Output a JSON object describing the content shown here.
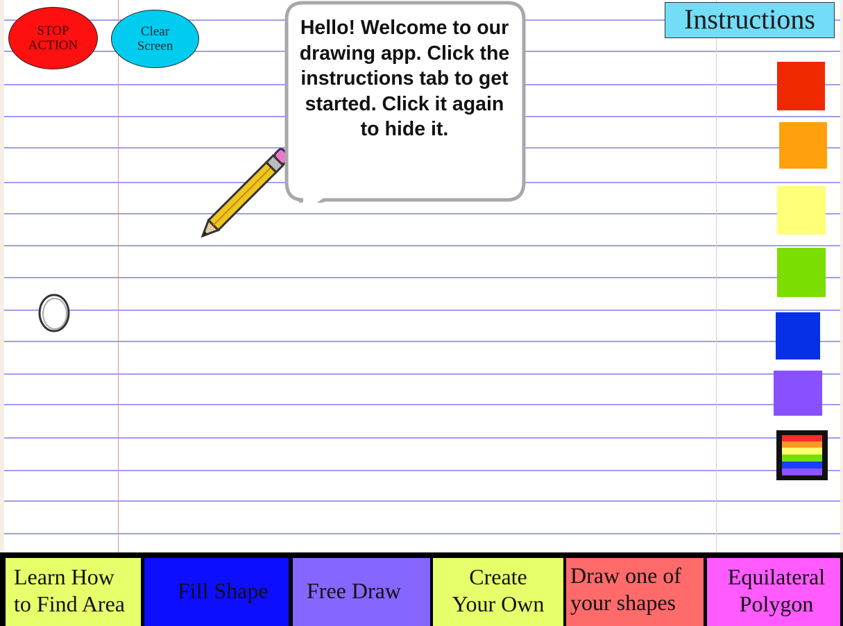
{
  "buttons": {
    "stop_action": "STOP\nACTION",
    "clear_screen": "Clear\nScreen",
    "instructions": "Instructions"
  },
  "speech_bubble": {
    "text": "Hello! Welcome to our drawing app. Click the instructions tab to get started. Click it again to hide it."
  },
  "palette": [
    {
      "name": "red",
      "color": "#f02800"
    },
    {
      "name": "orange",
      "color": "#fea10c"
    },
    {
      "name": "yellow",
      "color": "#ffff78"
    },
    {
      "name": "green",
      "color": "#7bdd00"
    },
    {
      "name": "blue",
      "color": "#0530e8"
    },
    {
      "name": "purple",
      "color": "#8950ff"
    },
    {
      "name": "rainbow",
      "color": "multi"
    }
  ],
  "toolbar": {
    "learn_area": "Learn How\nto Find Area",
    "fill_shape": "Fill Shape",
    "free_draw": "Free Draw",
    "create_own": "Create\nYour Own",
    "draw_shapes": "Draw one of\nyour shapes",
    "equilateral_polygon": "Equilateral\nPolygon"
  },
  "colors": {
    "toolbar_yellow": "#e7ff6a",
    "toolbar_blue": "#0d0dff",
    "toolbar_purple": "#8566ff",
    "toolbar_red": "#ff6a6a",
    "toolbar_magenta": "#ff5bff",
    "notebook_rule": "#8c8cf0",
    "margin_line": "#f08a8a"
  }
}
